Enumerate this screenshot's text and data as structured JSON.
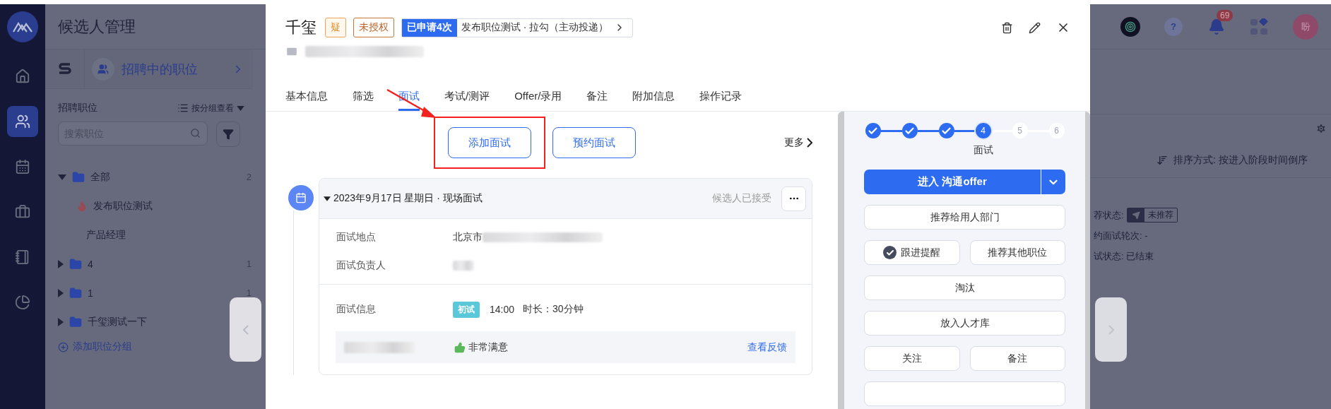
{
  "rail": {
    "items": [
      {
        "kind": "home",
        "selected": false
      },
      {
        "kind": "people",
        "selected": true
      },
      {
        "kind": "calendar",
        "selected": false
      },
      {
        "kind": "briefcase",
        "selected": false
      },
      {
        "kind": "book",
        "selected": false
      },
      {
        "kind": "chart",
        "selected": false
      }
    ]
  },
  "left_panel": {
    "title": "候选人管理",
    "job_filter": "招聘中的职位",
    "section_title": "招聘职位",
    "view_toggle": "按分组查看",
    "search": {
      "placeholder": "搜索职位"
    },
    "tree": [
      {
        "label": "全部",
        "count": "2",
        "expanded": true,
        "children": [
          {
            "label": "发布职位测试",
            "hot": true
          },
          {
            "label": "产品经理",
            "hot": false
          }
        ]
      },
      {
        "label": "4",
        "count": "1",
        "expanded": false
      },
      {
        "label": "1",
        "count": "1",
        "expanded": false
      },
      {
        "label": "千玺测试一下",
        "expanded": false
      }
    ],
    "add_group": "添加职位分组"
  },
  "modal": {
    "candidate": {
      "name": "千玺",
      "tags": [
        {
          "text": "疑",
          "kind": "warning"
        },
        {
          "text": "未授权",
          "kind": "outline"
        }
      ],
      "applied_badge": "已申请4次",
      "application": "发布职位测试 · 拉勾（主动投递）"
    },
    "tabs": [
      {
        "label": "基本信息",
        "selected": false
      },
      {
        "label": "筛选",
        "selected": false
      },
      {
        "label": "面试",
        "selected": true
      },
      {
        "label": "考试/测评",
        "selected": false
      },
      {
        "label": "Offer/录用",
        "selected": false
      },
      {
        "label": "备注",
        "selected": false
      },
      {
        "label": "附加信息",
        "selected": false
      },
      {
        "label": "操作记录",
        "selected": false
      }
    ],
    "actions": [
      {
        "label": "添加面试",
        "highlighted": true
      },
      {
        "label": "预约面试",
        "highlighted": false
      }
    ],
    "more": "更多",
    "interview": {
      "title": "2023年9月17日 星期日 · 现场面试",
      "status": "候选人已接受",
      "expanded": true,
      "fields": [
        {
          "label": "面试地点",
          "value": "北京市"
        },
        {
          "label": "面试负责人"
        }
      ],
      "info_label": "面试信息",
      "round_tag": "初试",
      "time": "14:00",
      "duration": "时长：30分钟",
      "rating": "非常满意",
      "feedback_link": "查看反馈"
    }
  },
  "stepper": {
    "steps": [
      {
        "done": true,
        "current": false
      },
      {
        "done": true,
        "current": false
      },
      {
        "done": true,
        "current": false
      },
      {
        "done": false,
        "current": true,
        "number": "4",
        "label": "面试"
      },
      {
        "done": false,
        "current": false,
        "number": "5"
      },
      {
        "done": false,
        "current": false,
        "number": "6"
      }
    ]
  },
  "side_actions": {
    "primary": "进入 沟通offer",
    "rows": [
      {
        "buttons": [
          {
            "label": "推荐给用人部门",
            "checked": false
          }
        ]
      },
      {
        "buttons": [
          {
            "label": "跟进提醒",
            "checked": true
          },
          {
            "label": "推荐其他职位",
            "checked": false
          }
        ]
      },
      {
        "buttons": [
          {
            "label": "淘汰",
            "checked": false
          }
        ]
      },
      {
        "buttons": [
          {
            "label": "放入人才库",
            "checked": false
          }
        ]
      },
      {
        "buttons": [
          {
            "label": "关注",
            "checked": false
          },
          {
            "label": "备注",
            "checked": false
          }
        ]
      }
    ]
  },
  "background": {
    "help": "?",
    "notifications": "69",
    "avatar": "盼",
    "sort": "排序方式: 按进入阶段时间倒序",
    "status_lines": [
      {
        "label": "荐状态:",
        "badge": "未推荐"
      },
      {
        "label": "约面试轮次: -"
      },
      {
        "label": "试状态: 已结束"
      }
    ]
  }
}
